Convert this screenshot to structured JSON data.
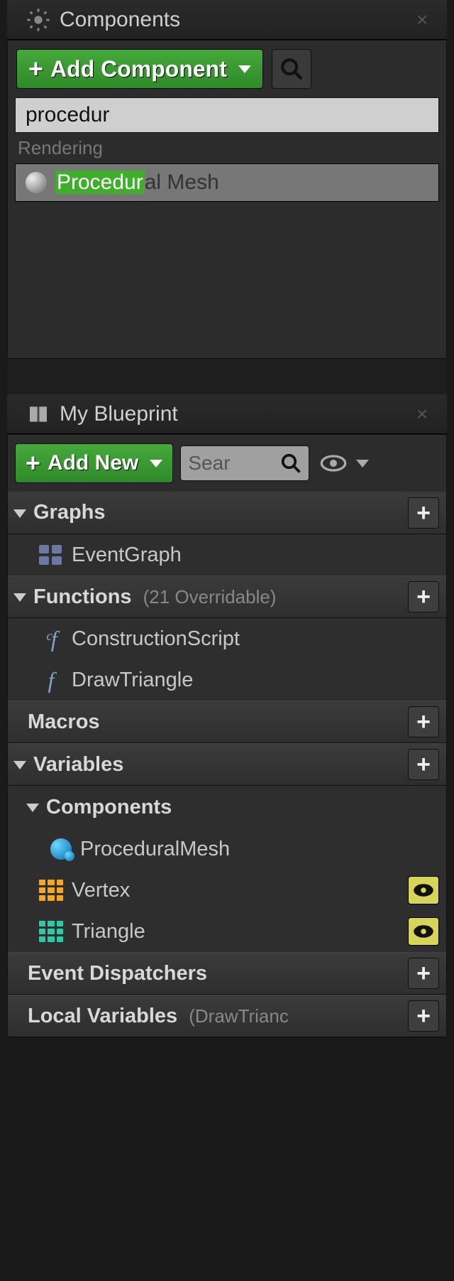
{
  "colors": {
    "accent_green": "#3fae2a",
    "panel_bg": "#2c2c2c"
  },
  "components_panel": {
    "tab_title": "Components",
    "add_button": "Add Component",
    "search_value": "procedur",
    "search_category": "Rendering",
    "search_result_highlight": "Procedur",
    "search_result_rest": "al Mesh"
  },
  "blueprint_panel": {
    "tab_title": "My Blueprint",
    "add_button": "Add New",
    "search_placeholder": "Sear",
    "sections": {
      "graphs": {
        "label": "Graphs",
        "items": [
          "EventGraph"
        ]
      },
      "functions": {
        "label": "Functions",
        "suffix": "(21 Overridable)",
        "items": [
          "ConstructionScript",
          "DrawTriangle"
        ]
      },
      "macros": {
        "label": "Macros"
      },
      "variables": {
        "label": "Variables"
      },
      "components": {
        "label": "Components",
        "items": [
          "ProceduralMesh",
          "Vertex",
          "Triangle"
        ]
      },
      "event_dispatchers": {
        "label": "Event Dispatchers"
      },
      "local_variables": {
        "label": "Local Variables",
        "suffix": "(DrawTrianc"
      }
    }
  }
}
